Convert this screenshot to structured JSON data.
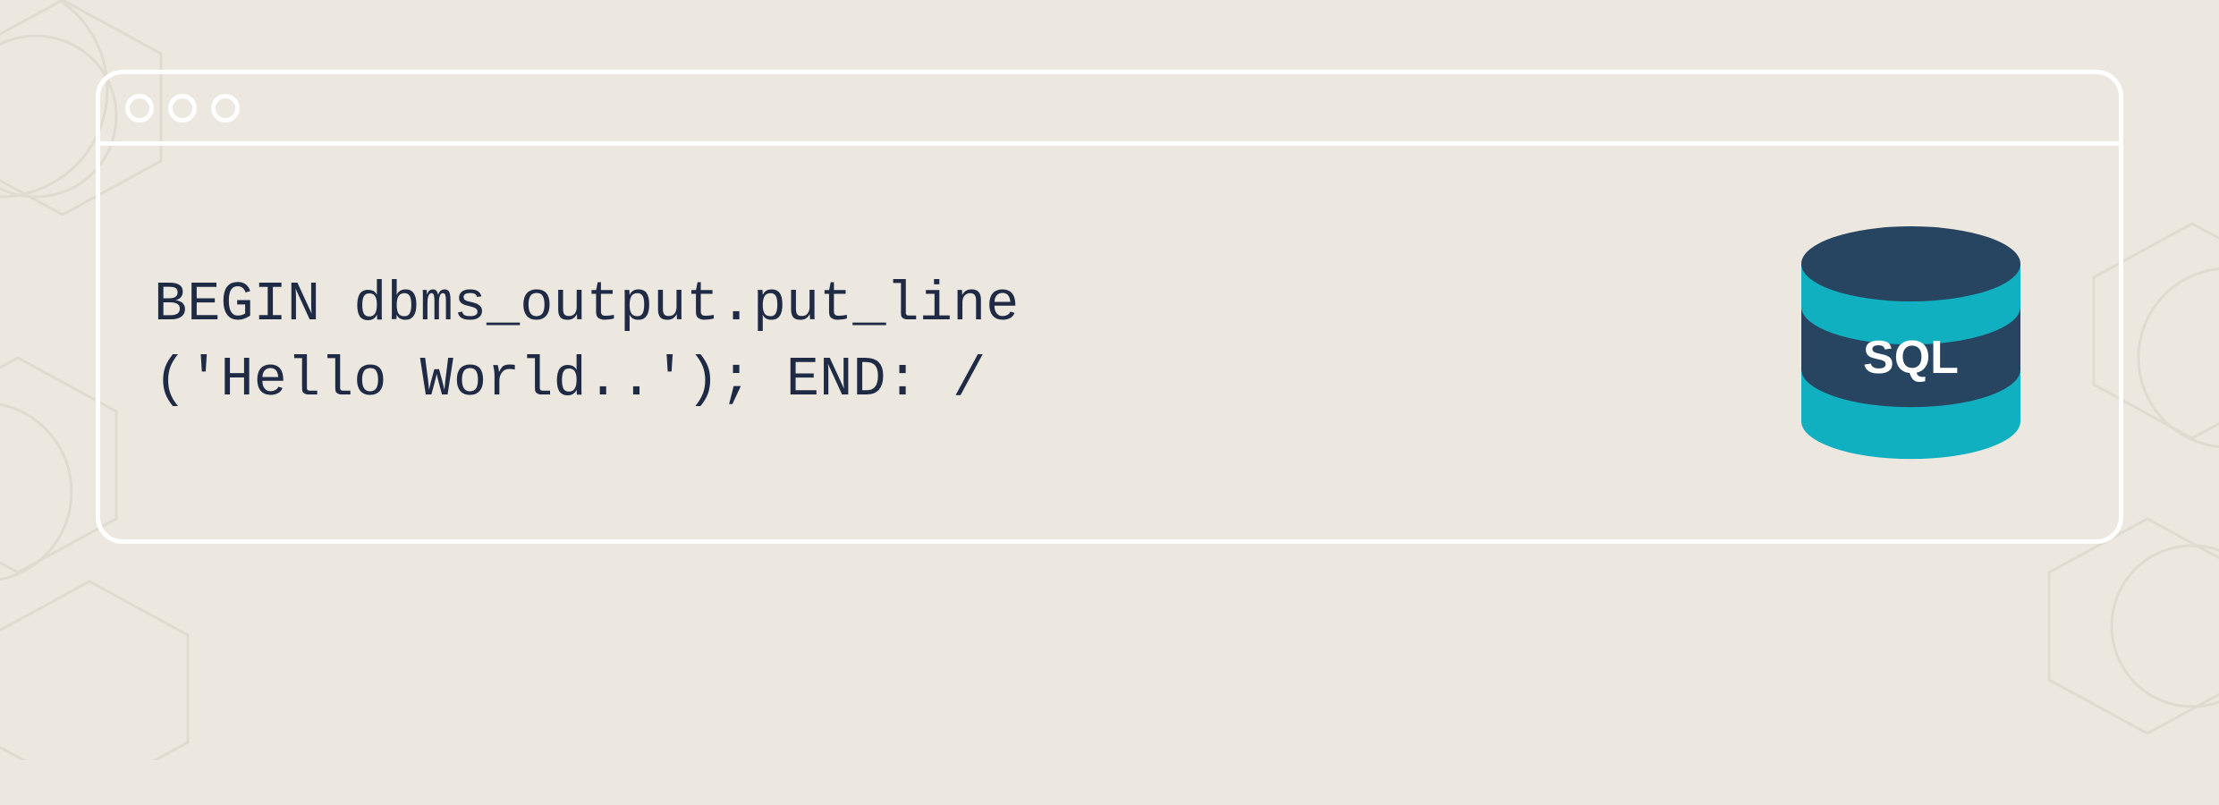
{
  "code": {
    "line1": "BEGIN dbms_output.put_line",
    "line2": "('Hello World..'); END: /"
  },
  "db_label": "SQL",
  "colors": {
    "background": "#ece8df",
    "window_border": "#ffffff",
    "code_text": "#1f2b45",
    "db_teal": "#10b0c0",
    "db_dark": "#274560",
    "db_label_text": "#ffffff"
  }
}
